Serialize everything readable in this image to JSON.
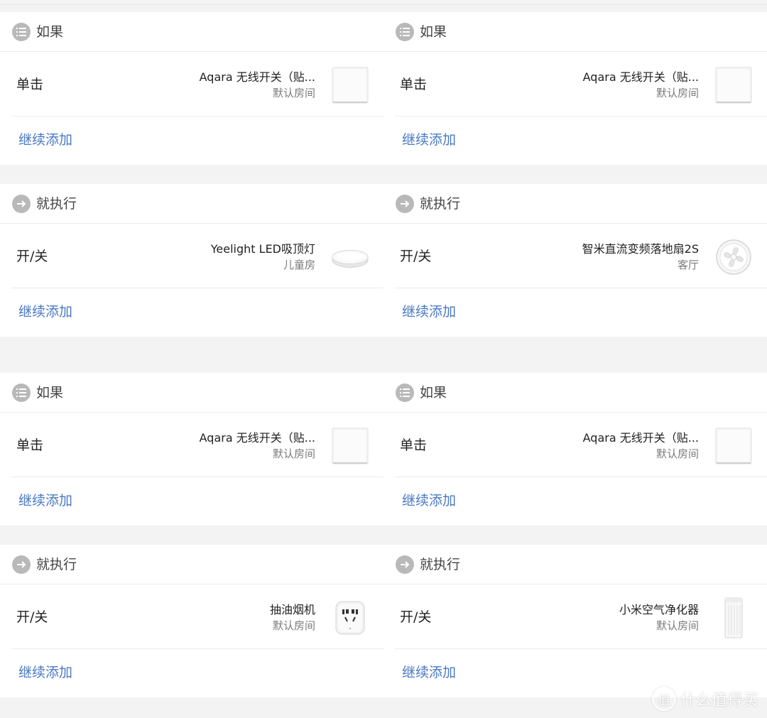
{
  "add_more_label": "继续添加",
  "if_label": "如果",
  "then_label": "就执行",
  "panels": [
    {
      "if": {
        "action": "单击",
        "device": "Aqara 无线开关（贴...",
        "room": "默认房间",
        "image": "wall-switch-image"
      },
      "then": {
        "action": "开/关",
        "device": "Yeelight LED吸顶灯",
        "room": "儿童房",
        "image": "ceiling-light-image"
      }
    },
    {
      "if": {
        "action": "单击",
        "device": "Aqara 无线开关（贴...",
        "room": "默认房间",
        "image": "wall-switch-image"
      },
      "then": {
        "action": "开/关",
        "device": "智米直流变频落地扇2S",
        "room": "客厅",
        "image": "fan-image"
      }
    },
    {
      "if": {
        "action": "单击",
        "device": "Aqara 无线开关（贴...",
        "room": "默认房间",
        "image": "wall-switch-image"
      },
      "then": {
        "action": "开/关",
        "device": "抽油烟机",
        "room": "默认房间",
        "image": "smart-plug-image"
      }
    },
    {
      "if": {
        "action": "单击",
        "device": "Aqara 无线开关（贴...",
        "room": "默认房间",
        "image": "wall-switch-image"
      },
      "then": {
        "action": "开/关",
        "device": "小米空气净化器",
        "room": "默认房间",
        "image": "air-purifier-image"
      }
    }
  ],
  "watermark": {
    "text": "什么值得买",
    "icon": "值"
  },
  "colors": {
    "link": "#4a79c4",
    "icon_gray": "#b9b9b9",
    "background": "#f3f3f3"
  }
}
